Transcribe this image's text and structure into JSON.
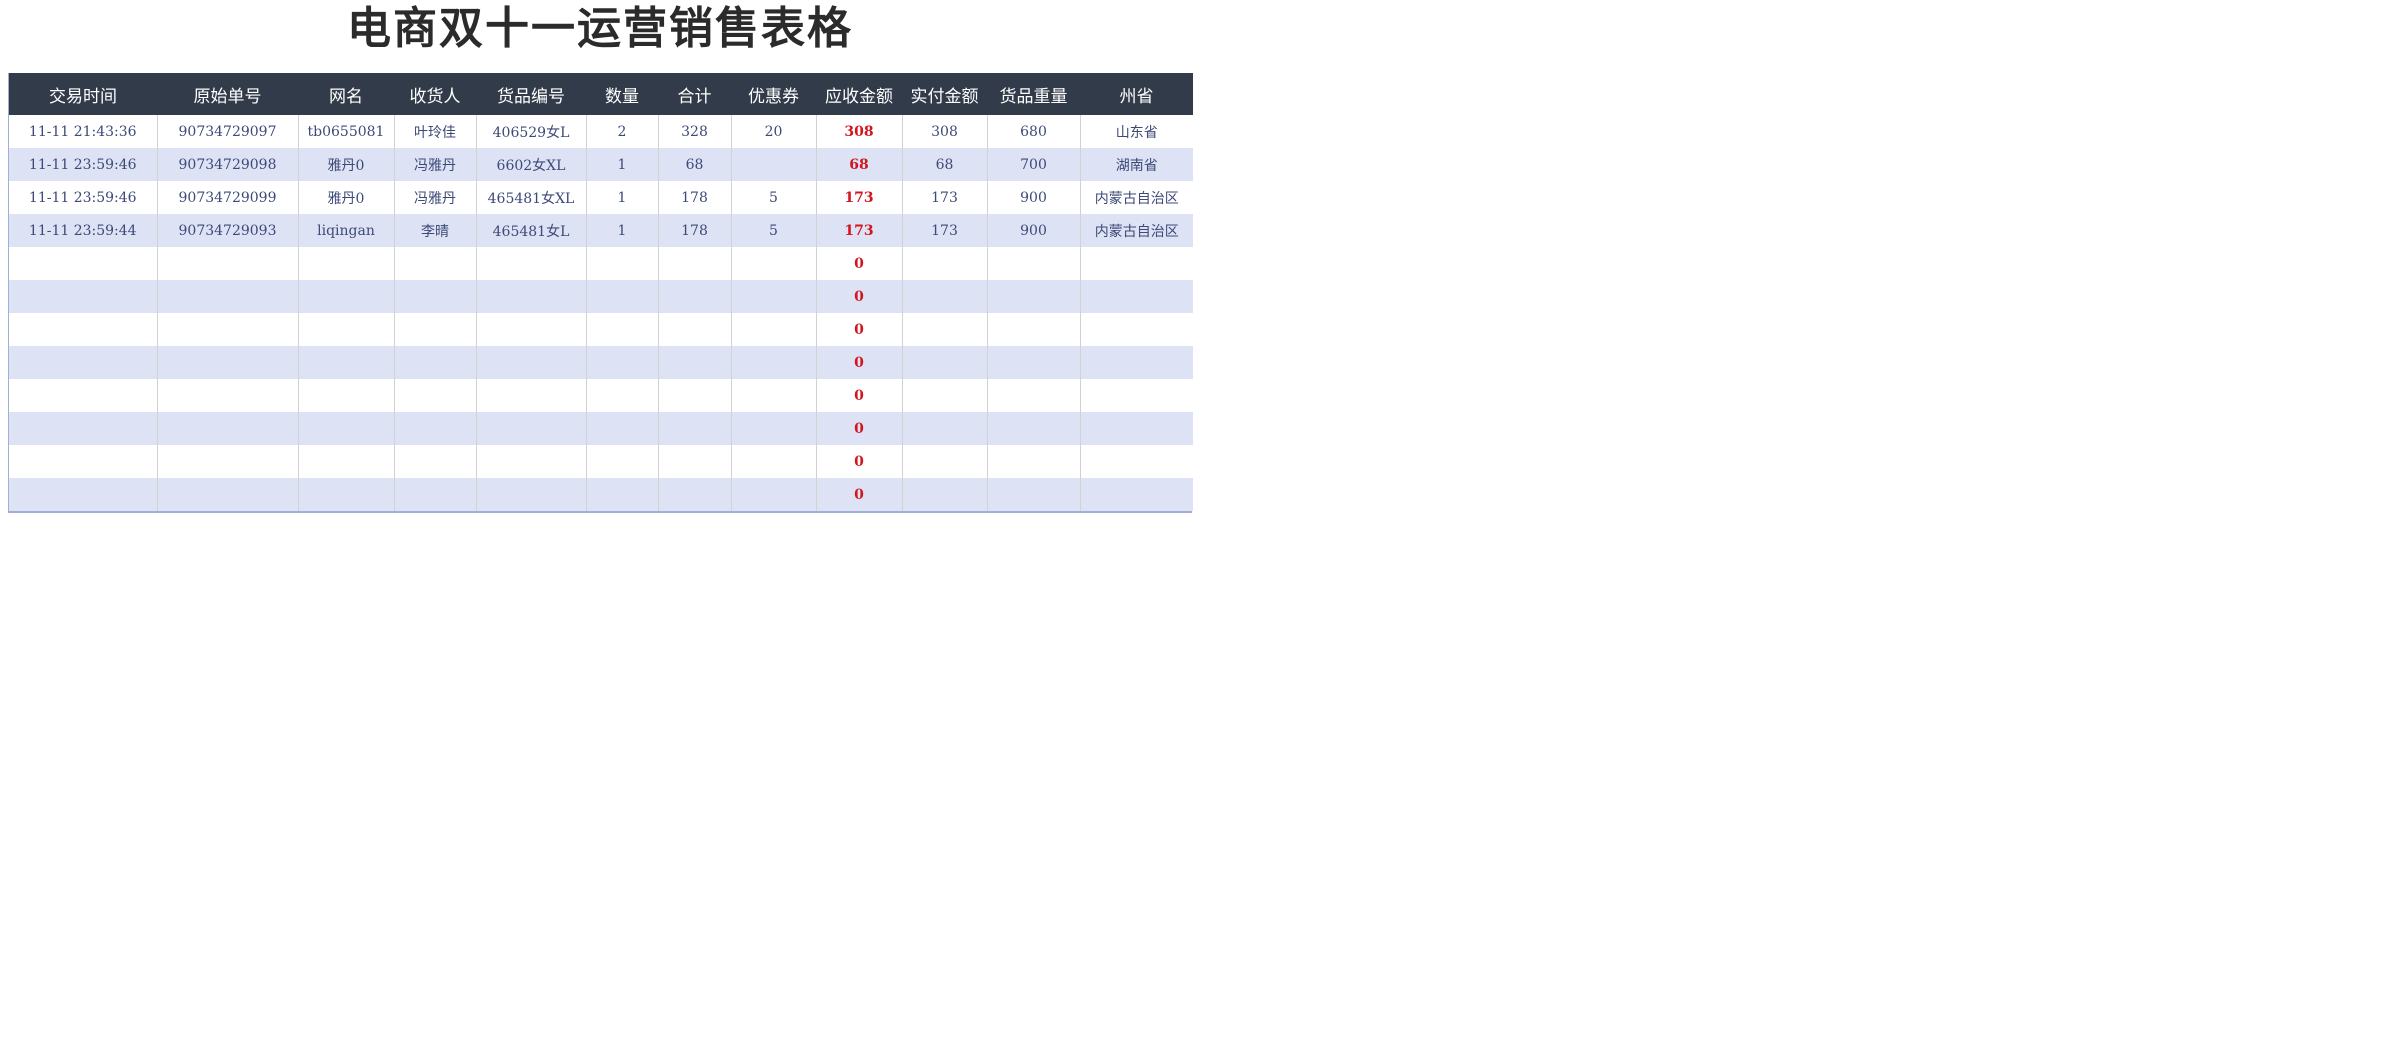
{
  "title": "电商双十一运营销售表格",
  "columns": [
    "交易时间",
    "原始单号",
    "网名",
    "收货人",
    "货品编号",
    "数量",
    "合计",
    "优惠券",
    "应收金额",
    "实付金额",
    "货品重量",
    "州省"
  ],
  "rows": [
    [
      "11-11 21:43:36",
      "90734729097",
      "tb0655081",
      "叶玲佳",
      "406529女L",
      "2",
      "328",
      "20",
      "308",
      "308",
      "680",
      "山东省"
    ],
    [
      "11-11 23:59:46",
      "90734729098",
      "雅丹0",
      "冯雅丹",
      "6602女XL",
      "1",
      "68",
      "",
      "68",
      "68",
      "700",
      "湖南省"
    ],
    [
      "11-11 23:59:46",
      "90734729099",
      "雅丹0",
      "冯雅丹",
      "465481女XL",
      "1",
      "178",
      "5",
      "173",
      "173",
      "900",
      "内蒙古自治区"
    ],
    [
      "11-11 23:59:44",
      "90734729093",
      "liqingan",
      "李晴",
      "465481女L",
      "1",
      "178",
      "5",
      "173",
      "173",
      "900",
      "内蒙古自治区"
    ],
    [
      "",
      "",
      "",
      "",
      "",
      "",
      "",
      "",
      "0",
      "",
      "",
      ""
    ],
    [
      "",
      "",
      "",
      "",
      "",
      "",
      "",
      "",
      "0",
      "",
      "",
      ""
    ],
    [
      "",
      "",
      "",
      "",
      "",
      "",
      "",
      "",
      "0",
      "",
      "",
      ""
    ],
    [
      "",
      "",
      "",
      "",
      "",
      "",
      "",
      "",
      "0",
      "",
      "",
      ""
    ],
    [
      "",
      "",
      "",
      "",
      "",
      "",
      "",
      "",
      "0",
      "",
      "",
      ""
    ],
    [
      "",
      "",
      "",
      "",
      "",
      "",
      "",
      "",
      "0",
      "",
      "",
      ""
    ],
    [
      "",
      "",
      "",
      "",
      "",
      "",
      "",
      "",
      "0",
      "",
      "",
      ""
    ],
    [
      "",
      "",
      "",
      "",
      "",
      "",
      "",
      "",
      "0",
      "",
      "",
      ""
    ]
  ],
  "colors": {
    "header_bg": "#323b4a",
    "header_text": "#ffffff",
    "row_even_bg": "#dde2f4",
    "row_odd_bg": "#ffffff",
    "cell_text": "#3d4a78",
    "amount_due_text": "#d0161f"
  }
}
